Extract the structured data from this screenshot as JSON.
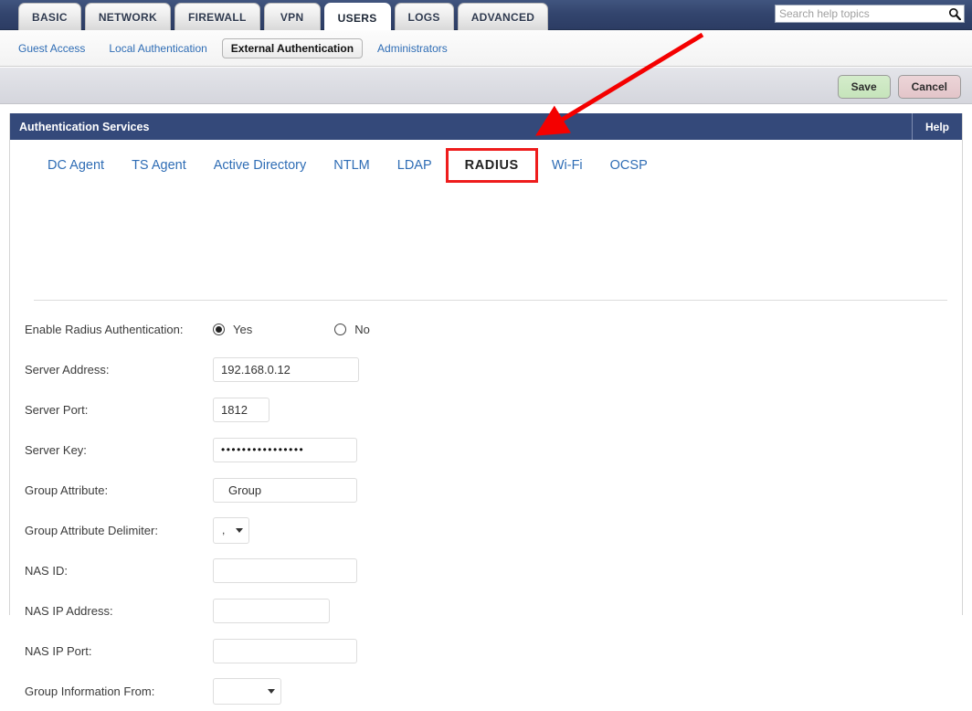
{
  "header": {
    "main_tabs": [
      {
        "label": "BASIC",
        "active": false
      },
      {
        "label": "NETWORK",
        "active": false
      },
      {
        "label": "FIREWALL",
        "active": false
      },
      {
        "label": "VPN",
        "active": false
      },
      {
        "label": "USERS",
        "active": true
      },
      {
        "label": "LOGS",
        "active": false
      },
      {
        "label": "ADVANCED",
        "active": false
      }
    ],
    "search": {
      "placeholder": "Search help topics",
      "value": "",
      "icon": "search-icon"
    }
  },
  "subnav": {
    "items": [
      {
        "label": "Guest Access",
        "active": false
      },
      {
        "label": "Local Authentication",
        "active": false
      },
      {
        "label": "External Authentication",
        "active": true
      },
      {
        "label": "Administrators",
        "active": false
      }
    ]
  },
  "toolbar": {
    "save_label": "Save",
    "cancel_label": "Cancel"
  },
  "panel": {
    "title": "Authentication Services",
    "help_label": "Help",
    "tabs": [
      {
        "label": "DC Agent",
        "active": false
      },
      {
        "label": "TS Agent",
        "active": false
      },
      {
        "label": "Active Directory",
        "active": false
      },
      {
        "label": "NTLM",
        "active": false
      },
      {
        "label": "LDAP",
        "active": false
      },
      {
        "label": "RADIUS",
        "active": true
      },
      {
        "label": "Wi-Fi",
        "active": false
      },
      {
        "label": "OCSP",
        "active": false
      }
    ]
  },
  "form": {
    "enable_radius": {
      "label": "Enable Radius Authentication:",
      "yes_label": "Yes",
      "no_label": "No",
      "selected": "Yes"
    },
    "server_address": {
      "label": "Server Address:",
      "value": "192.168.0.12"
    },
    "server_port": {
      "label": "Server Port:",
      "value": "1812"
    },
    "server_key": {
      "label": "Server Key:",
      "value": "••••••••••••••••"
    },
    "group_attribute": {
      "label": "Group Attribute:",
      "value": "Group"
    },
    "group_attribute_delimiter": {
      "label": "Group Attribute Delimiter:",
      "value": ","
    },
    "nas_id": {
      "label": "NAS ID:",
      "value": ""
    },
    "nas_ip_address": {
      "label": "NAS IP Address:",
      "value": ""
    },
    "nas_ip_port": {
      "label": "NAS IP Port:",
      "value": ""
    },
    "group_information_from": {
      "label": "Group Information From:",
      "value": ""
    }
  },
  "annotation": {
    "arrow_color": "#f40000",
    "highlight_color": "#ee1c1c"
  },
  "colors": {
    "topbar": "#34497a",
    "link": "#2f6db5",
    "save_bg": "#c6e4bb",
    "cancel_bg": "#e3c5c9"
  }
}
